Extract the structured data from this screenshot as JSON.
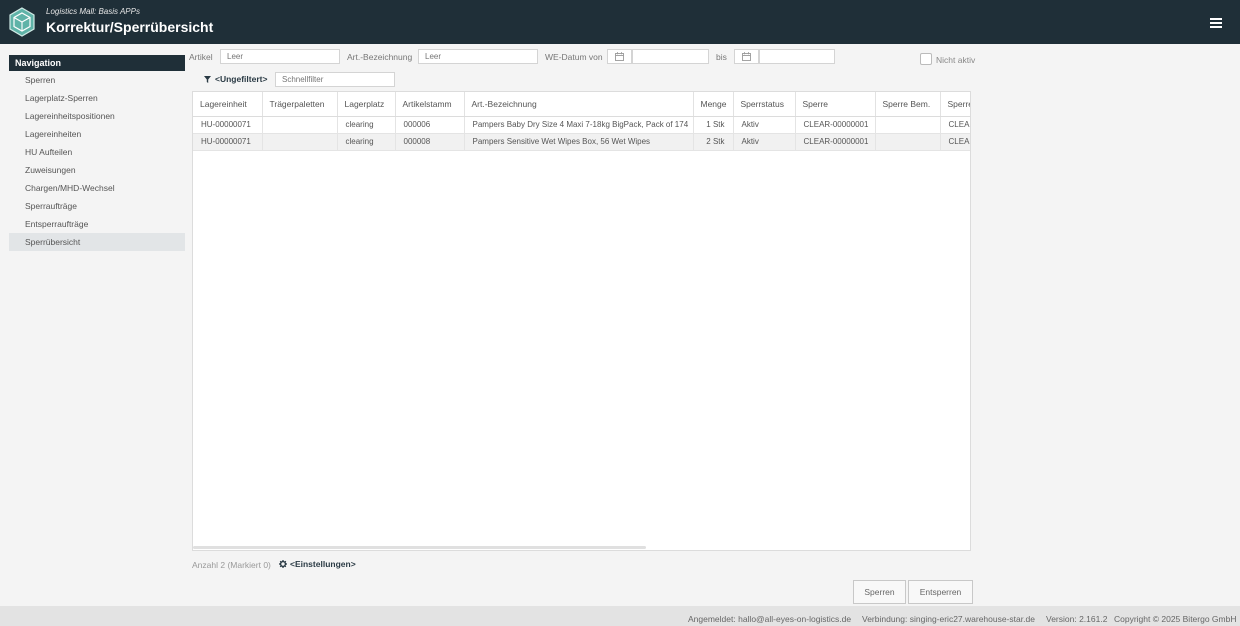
{
  "header": {
    "subtitle": "Logistics Mall: Basis APPs",
    "title": "Korrektur/Sperrübersicht",
    "logo_icon": "hexagon-cube-logo",
    "menu_icon": "hamburger-icon"
  },
  "nav": {
    "title": "Navigation",
    "items": [
      {
        "label": "Sperren"
      },
      {
        "label": "Lagerplatz-Sperren"
      },
      {
        "label": "Lagereinheitspositionen"
      },
      {
        "label": "Lagereinheiten"
      },
      {
        "label": "HU Aufteilen"
      },
      {
        "label": "Zuweisungen"
      },
      {
        "label": "Chargen/MHD-Wechsel"
      },
      {
        "label": "Sperraufträge"
      },
      {
        "label": "Entsperraufträge"
      },
      {
        "label": "Sperrübersicht",
        "active": true
      }
    ]
  },
  "filters": {
    "artikel_label": "Artikel",
    "artikel_placeholder": "Leer",
    "bezeichnung_label": "Art.-Bezeichnung",
    "bezeichnung_placeholder": "Leer",
    "we_datum_label": "WE-Datum von",
    "bis_label": "bis",
    "nicht_aktiv_label": "Nicht aktiv",
    "nicht_aktiv_checked": false,
    "filter_toggle_label": "<Ungefiltert>",
    "schnellfilter_placeholder": "Schnellfilter"
  },
  "table": {
    "columns": [
      "Lagereinheit",
      "Trägerpaletten",
      "Lagerplatz",
      "Artikelstamm",
      "Art.-Bezeichnung",
      "Menge",
      "Sperrstatus",
      "Sperre",
      "Sperre Bem.",
      "Sperre"
    ],
    "rows": [
      [
        "HU-00000071",
        "",
        "clearing",
        "000006",
        "Pampers Baby Dry Size 4 Maxi 7-18kg BigPack, Pack of 174",
        "1 Stk",
        "Aktiv",
        "CLEAR-00000001",
        "",
        "CLEAR"
      ],
      [
        "HU-00000071",
        "",
        "clearing",
        "000008",
        "Pampers Sensitive Wet Wipes Box, 56 Wet Wipes",
        "2 Stk",
        "Aktiv",
        "CLEAR-00000001",
        "",
        "CLEAR"
      ]
    ]
  },
  "footer": {
    "count_text": "Anzahl 2 (Markiert 0)",
    "settings_label": "<Einstellungen>",
    "sperren_button": "Sperren",
    "entsperren_button": "Entsperren"
  },
  "status": {
    "user": "Angemeldet: hallo@all-eyes-on-logistics.de",
    "connection": "Verbindung: singing-eric27.warehouse-star.de",
    "version": "Version: 2.161.2",
    "copyright": "Copyright © 2025 Bitergo GmbH"
  },
  "colors": {
    "header_bg": "#1f2f38",
    "logo_accent": "#5fb3a8"
  }
}
